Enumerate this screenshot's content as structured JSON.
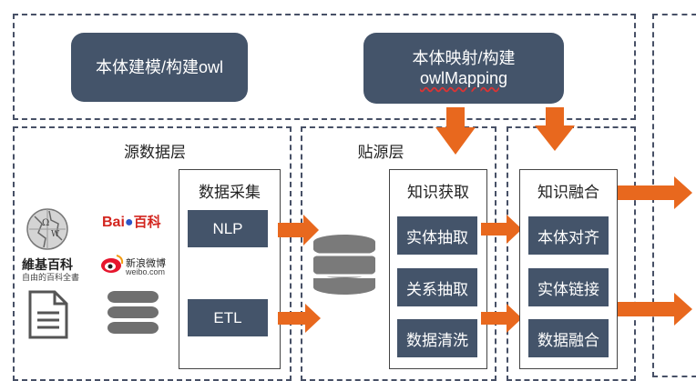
{
  "top": {
    "modeling": "本体建模/构建owl",
    "mapping_line1": "本体映射/构建",
    "mapping_line2": "owlMapping"
  },
  "source_layer": {
    "title": "源数据层",
    "wiki_line1": "維基百科",
    "wiki_line2": "自由的百科全書",
    "baidu_prefix": "Bai",
    "baidu_suffix": "百科",
    "weibo_line1": "新浪微博",
    "weibo_line2": "weibo.com",
    "collect_title": "数据采集",
    "nlp": "NLP",
    "etl": "ETL"
  },
  "staging_layer": {
    "title": "贴源层",
    "extract_title": "知识获取",
    "items": [
      "实体抽取",
      "关系抽取",
      "数据清洗"
    ]
  },
  "fusion": {
    "title": "知识融合",
    "items": [
      "本体对齐",
      "实体链接",
      "数据融合"
    ]
  },
  "colors": {
    "navy": "#44546a",
    "arrow": "#e8681e",
    "dash": "#475066"
  }
}
